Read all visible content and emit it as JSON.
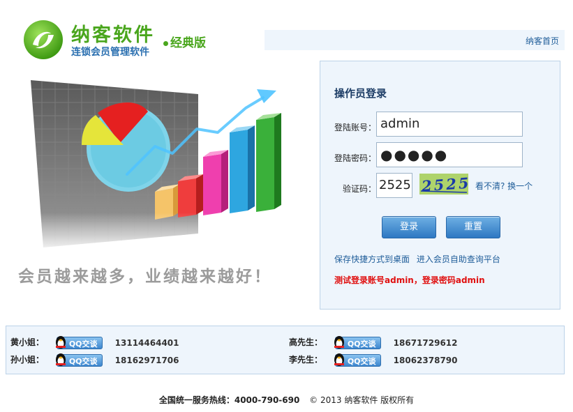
{
  "logo": {
    "name": "纳客软件",
    "subtitle": "连锁会员管理软件",
    "edition": "经典版"
  },
  "topbar": {
    "home_link": "纳客首页"
  },
  "slogan": "会员越来越多，业绩越来越好！",
  "login": {
    "title": "操作员登录",
    "account_label": "登陆账号：",
    "account_value": "admin",
    "password_label": "登陆密码：",
    "password_masked": "●●●●●",
    "captcha_label": "验证码：",
    "captcha_value": "2525",
    "captcha_image_text": "2525",
    "captcha_refresh": "看不清? 换一个",
    "login_button": "登录",
    "reset_button": "重置",
    "link_shortcut": "保存快捷方式到桌面",
    "link_self_service": "进入会员自助查询平台",
    "test_notice": "测试登录账号admin，登录密码admin"
  },
  "contacts": [
    {
      "name": "黄小姐：",
      "qq_label": "QQ交谈",
      "phone": "13114464401"
    },
    {
      "name": "孙小姐：",
      "qq_label": "QQ交谈",
      "phone": "18162971706"
    },
    {
      "name": "高先生：",
      "qq_label": "QQ交谈",
      "phone": "18671729612"
    },
    {
      "name": "李先生：",
      "qq_label": "QQ交谈",
      "phone": "18062378790"
    }
  ],
  "footer": {
    "hotline": "全国统一服务热线：4000-790-690",
    "copyright": "© 2013 纳客软件 版权所有"
  },
  "colors": {
    "brand_green": "#4aa61d",
    "brand_blue": "#2a6fb0",
    "panel_bg": "#eef5fc",
    "button_blue": "#2e78c2",
    "notice_red": "#e01010"
  }
}
